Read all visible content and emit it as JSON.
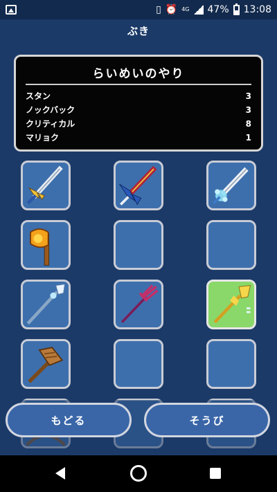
{
  "status_bar": {
    "battery": "47%",
    "time": "13:08",
    "network": "4G",
    "icons": [
      "image-icon",
      "vibrate-icon",
      "alarm-icon",
      "signal-icon",
      "battery-icon"
    ]
  },
  "page_title": "ぶき",
  "info_panel": {
    "weapon_name": "らいめいのやり",
    "stats": [
      {
        "label": "スタン",
        "value": "3"
      },
      {
        "label": "ノックバック",
        "value": "3"
      },
      {
        "label": "クリティカル",
        "value": "8"
      },
      {
        "label": "マリョク",
        "value": "1"
      }
    ]
  },
  "weapons": [
    {
      "icon": "winged-sword-icon",
      "empty": false,
      "selected": false
    },
    {
      "icon": "crimson-greatsword-icon",
      "empty": false,
      "selected": false
    },
    {
      "icon": "ice-sword-icon",
      "empty": false,
      "selected": false
    },
    {
      "icon": "fire-axe-icon",
      "empty": false,
      "selected": false
    },
    {
      "icon": "empty-slot",
      "empty": true,
      "selected": false
    },
    {
      "icon": "empty-slot",
      "empty": true,
      "selected": false
    },
    {
      "icon": "ice-spear-icon",
      "empty": false,
      "selected": false
    },
    {
      "icon": "trident-icon",
      "empty": false,
      "selected": false
    },
    {
      "icon": "thunder-spear-icon",
      "empty": false,
      "selected": true
    },
    {
      "icon": "wooden-hammer-icon",
      "empty": false,
      "selected": false
    },
    {
      "icon": "empty-slot",
      "empty": true,
      "selected": false
    },
    {
      "icon": "empty-slot",
      "empty": true,
      "selected": false
    },
    {
      "icon": "bow-icon",
      "empty": false,
      "selected": false
    },
    {
      "icon": "empty-slot",
      "empty": true,
      "selected": false
    },
    {
      "icon": "empty-slot",
      "empty": true,
      "selected": false
    }
  ],
  "buttons": {
    "back_label": "もどる",
    "equip_label": "そうび"
  },
  "colors": {
    "background": "#1b3a68",
    "slot": "#3d6fad",
    "selected_slot": "#8ad86a",
    "panel": "#050505"
  }
}
